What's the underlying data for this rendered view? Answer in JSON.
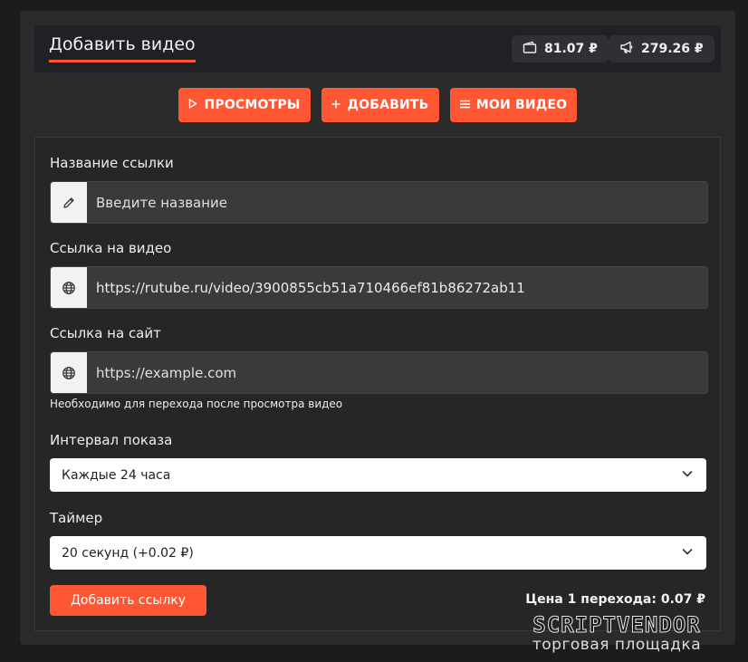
{
  "header": {
    "title": "Добавить видео",
    "balance_wallet": "81.07 ₽",
    "balance_ads": "279.26 ₽"
  },
  "nav": {
    "views": "ПРОСМОТРЫ",
    "add": "ДОБАВИТЬ",
    "my_videos": "МОИ ВИДЕО"
  },
  "form": {
    "link_name_label": "Название ссылки",
    "link_name_placeholder": "Введите название",
    "video_url_label": "Ссылка на видео",
    "video_url_value": "https://rutube.ru/video/3900855cb51a710466ef81b86272ab11",
    "site_url_label": "Ссылка на сайт",
    "site_url_placeholder": "https://example.com",
    "site_url_hint": "Необходимо для перехода после просмотра видео",
    "interval_label": "Интервал показа",
    "interval_value": "Каждые 24 часа",
    "timer_label": "Таймер",
    "timer_value": "20 секунд (+0.02 ₽)",
    "submit_label": "Добавить ссылку",
    "price_text": "Цена 1 перехода: 0.07 ₽"
  },
  "watermark": {
    "logo": "SCRIPTVENDOR",
    "subtitle": "торговая площадка"
  },
  "icons": {
    "wallet": "wallet-icon",
    "megaphone": "megaphone-icon",
    "play": "play-icon",
    "plus": "plus-icon",
    "menu": "menu-icon",
    "pencil": "pencil-icon",
    "globe": "globe-icon",
    "chevron": "chevron-down-icon"
  },
  "colors": {
    "accent": "#ff5733",
    "card": "#2a2a2a",
    "header": "#1f2124",
    "input": "#3a3a3a"
  }
}
